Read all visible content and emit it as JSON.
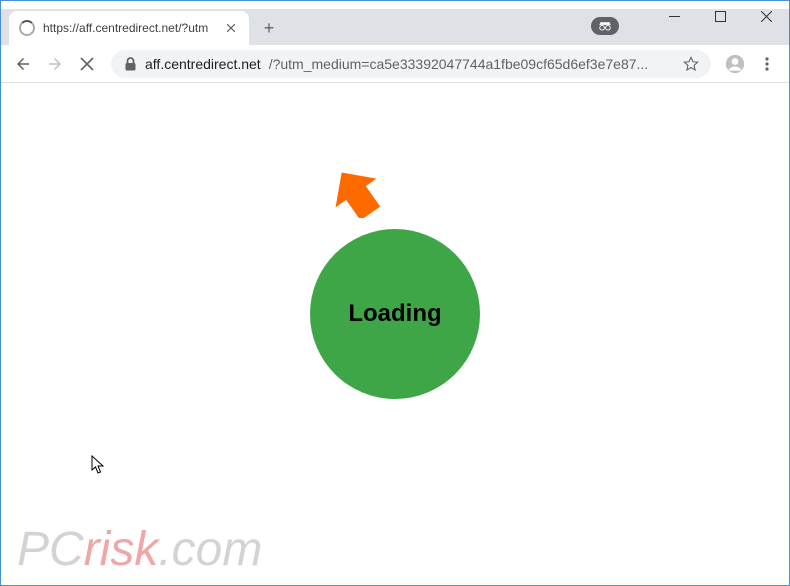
{
  "window": {
    "minimize": "–",
    "maximize": "☐",
    "close": "✕"
  },
  "tab": {
    "title": "https://aff.centredirect.net/?utm",
    "close": "✕"
  },
  "toolbar": {
    "new_tab": "+",
    "url_host": "aff.centredirect.net",
    "url_path": "/?utm_medium=ca5e33392047744a1fbe09cf65d6ef3e7e87..."
  },
  "content": {
    "loading_text": "Loading",
    "loading_color": "#3fa648"
  },
  "watermark": {
    "pc": "PC",
    "risk": "risk",
    "com": ".com"
  }
}
